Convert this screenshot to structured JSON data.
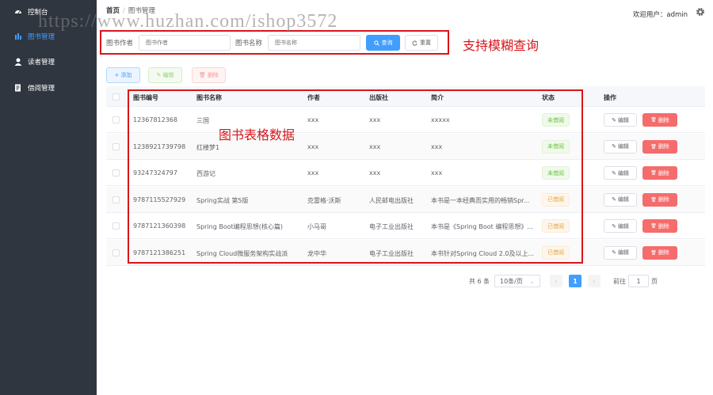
{
  "sidebar": {
    "items": [
      {
        "label": "控制台",
        "icon": "dashboard-icon"
      },
      {
        "label": "图书管理",
        "icon": "book-icon"
      },
      {
        "label": "读者管理",
        "icon": "user-icon"
      },
      {
        "label": "借阅管理",
        "icon": "borrow-icon"
      }
    ],
    "active_index": 1
  },
  "header": {
    "breadcrumb_home": "首页",
    "breadcrumb_sep": "/",
    "breadcrumb_current": "图书管理",
    "welcome": "欢迎用户：admin"
  },
  "watermark": "https://www.huzhan.com/ishop3572",
  "search": {
    "author_label": "图书作者",
    "author_placeholder": "图书作者",
    "name_label": "图书名称",
    "name_placeholder": "图书名称",
    "search_button": "查询",
    "reset_button": "重置"
  },
  "annotations": {
    "search_note": "支持模糊查询",
    "table_note": "图书表格数据"
  },
  "toolbar": {
    "add": "+ 添加",
    "edit": "编辑",
    "delete": "删除"
  },
  "table": {
    "columns": [
      "图书编号",
      "图书名称",
      "作者",
      "出版社",
      "简介",
      "状态",
      "操作"
    ],
    "rows": [
      {
        "id": "12367812368",
        "name": "三国",
        "author": "xxx",
        "publisher": "xxx",
        "intro": "xxxxx",
        "status": "未借阅"
      },
      {
        "id": "1238921739798",
        "name": "红楼梦1",
        "author": "xxx",
        "publisher": "xxx",
        "intro": "xxx",
        "status": "未借阅"
      },
      {
        "id": "93247324797",
        "name": "西游记",
        "author": "xxx",
        "publisher": "xxx",
        "intro": "xxx",
        "status": "未借阅"
      },
      {
        "id": "9787115527929",
        "name": "Spring实战 第5版",
        "author": "克雷格·沃斯",
        "publisher": "人民邮电出版社",
        "intro": "本书是一本经典而实用的畅销Spr...",
        "status": "已借阅"
      },
      {
        "id": "9787121360398",
        "name": "Spring Boot编程思想(核心篇)",
        "author": "小马哥",
        "publisher": "电子工业出版社",
        "intro": "本书是《Spring Boot 编程思想》...",
        "status": "已借阅"
      },
      {
        "id": "9787121386251",
        "name": "Spring Cloud微服务架构实战派",
        "author": "龙中华",
        "publisher": "电子工业出版社",
        "intro": "本书针对Spring Cloud 2.0及以上...",
        "status": "已借阅"
      }
    ],
    "edit_label": "编辑",
    "delete_label": "删除"
  },
  "pagination": {
    "total": "共 6 条",
    "page_size": "10条/页",
    "current_page": "1",
    "goto_label": "前往",
    "goto_value": "1",
    "page_suffix": "页"
  },
  "colors": {
    "sidebar_bg": "#2f3640",
    "accent": "#409eff",
    "danger": "#f56c6c",
    "success": "#67c23a",
    "warning": "#e6a23c",
    "annotation": "#d9151a"
  }
}
